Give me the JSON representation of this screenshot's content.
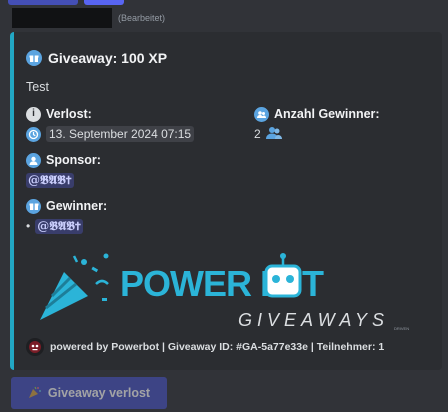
{
  "message": {
    "edited_label": "(Bearbeitet)"
  },
  "embed": {
    "title": "Giveaway: 100 XP",
    "description": "Test",
    "fields": {
      "drawn_label": "Verlost:",
      "drawn_value": "13. September 2024 07:15",
      "winner_count_label": "Anzahl Gewinner:",
      "winner_count_value": "2",
      "sponsor_label": "Sponsor:",
      "sponsor_value": "@𝕭𝕬𝕭✝",
      "winners_label": "Gewinner:",
      "winners_bullet": "•",
      "winners_value": "@𝕭𝕬𝕭✝"
    },
    "banner": {
      "brand_word_1": "POWER B",
      "brand_word_2": "T",
      "brand_sub": "GIVEAWAYS",
      "tiny_credit": "DRIVEN"
    },
    "footer": "powered by Powerbot | Giveaway ID: #GA-5a77e33e | Teilnehmer: 1"
  },
  "action": {
    "button_label": "Giveaway verlost"
  },
  "colors": {
    "accent_bar": "#22a7c4",
    "blurple": "#5865f2",
    "banner_cyan": "#2bb4d8"
  },
  "icons": {
    "title": "gift-icon",
    "drawn": "info-icon",
    "date": "clock-icon",
    "winner_count": "users-icon",
    "sponsor": "user-icon",
    "winners": "gift-icon",
    "button": "party-popper-icon"
  }
}
